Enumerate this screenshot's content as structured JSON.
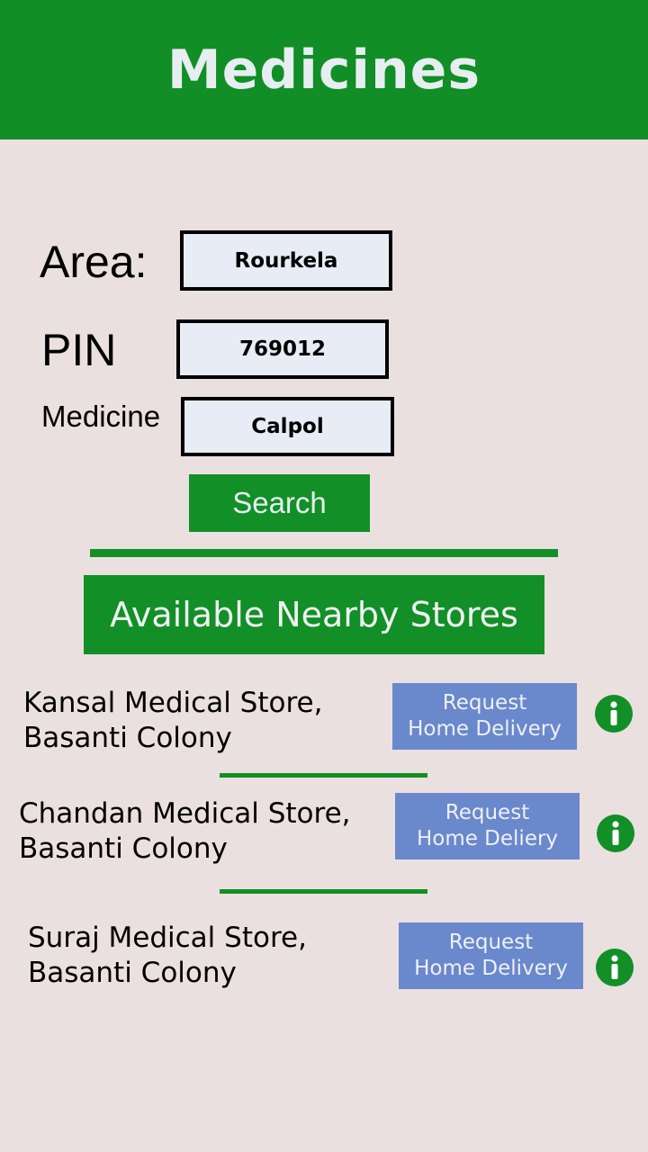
{
  "header": {
    "title": "Medicines"
  },
  "form": {
    "area": {
      "label": "Area:",
      "value": "Rourkela"
    },
    "pin": {
      "label": "PIN",
      "value": "769012"
    },
    "medicine": {
      "label": "Medicine",
      "value": "Calpol"
    },
    "search_label": "Search"
  },
  "results": {
    "title": "Available Nearby Stores",
    "stores": [
      {
        "name": "Kansal Medical Store,\nBasanti Colony",
        "button_line1": "Request",
        "button_line2": "Home Delivery"
      },
      {
        "name": "Chandan Medical Store,\nBasanti Colony",
        "button_line1": "Request",
        "button_line2": "Home Deliery"
      },
      {
        "name": "Suraj Medical Store,\nBasanti Colony",
        "button_line1": "Request",
        "button_line2": "Home Delivery"
      }
    ]
  },
  "icons": {
    "info": "info-icon"
  },
  "colors": {
    "brand_green": "#128f26",
    "button_blue": "#6a88cc",
    "background": "#ebe0e0"
  }
}
